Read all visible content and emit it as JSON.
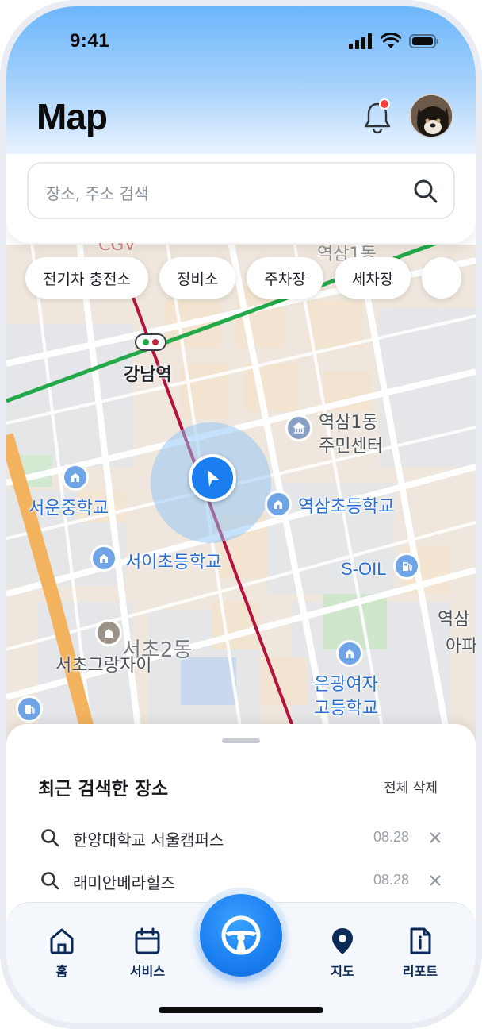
{
  "status_bar": {
    "time": "9:41"
  },
  "header": {
    "title": "Map"
  },
  "search": {
    "placeholder": "장소, 주소 검색"
  },
  "chips": [
    {
      "label": "전기차 충전소"
    },
    {
      "label": "정비소"
    },
    {
      "label": "주차장"
    },
    {
      "label": "세차장"
    }
  ],
  "map": {
    "labels": {
      "station": "강남역",
      "cgv": "CGV",
      "yeoksam_top": "역삼1동",
      "community_center_line1": "역삼1동",
      "community_center_line2": "주민센터",
      "school_seoun": "서운중학교",
      "school_yeoksam": "역삼초등학교",
      "school_seoi": "서이초등학교",
      "soil": "S-OIL",
      "apt_yeoksam_line1": "역삼",
      "apt_yeoksam_line2": "아파",
      "seocho2": "서초2동",
      "seocho_grang": "서초그랑자이",
      "school_eungwang_line1": "은광여자",
      "school_eungwang_line2": "고등학교"
    },
    "colors": {
      "subway_line2": "#23a84a",
      "subway_sinbundang": "#b5123d",
      "highway": "#f3b25e",
      "location": "#1a7ef0"
    }
  },
  "recent": {
    "title": "최근 검색한 장소",
    "clear_label": "전체 삭제",
    "items": [
      {
        "name": "한양대학교 서울캠퍼스",
        "date": "08.28"
      },
      {
        "name": "래미안베라힐즈",
        "date": "08.28"
      }
    ]
  },
  "nav": {
    "items": [
      {
        "label": "홈",
        "icon": "home-icon"
      },
      {
        "label": "서비스",
        "icon": "calendar-icon"
      },
      {
        "label": "",
        "icon": "steering-wheel-icon"
      },
      {
        "label": "지도",
        "icon": "map-pin-icon"
      },
      {
        "label": "리포트",
        "icon": "report-icon"
      }
    ]
  }
}
